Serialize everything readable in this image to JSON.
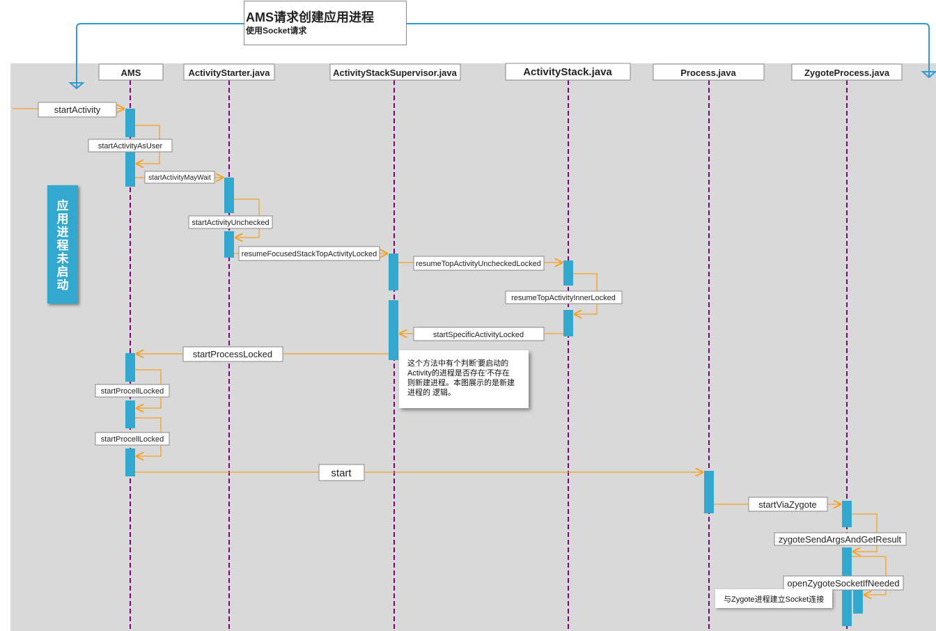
{
  "title": {
    "main": "AMS请求创建应用进程",
    "sub": "使用Socket请求"
  },
  "side_label": [
    "应",
    "用",
    "进",
    "程",
    "未",
    "启",
    "动"
  ],
  "participants": [
    "AMS",
    "ActivityStarter.java",
    "ActivityStackSupervisor.java",
    "ActivityStack.java",
    "Process.java",
    "ZygoteProcess.java"
  ],
  "messages": {
    "startActivity": "startActivity",
    "startActivityAsUser": "startActivityAsUser",
    "startActivityMayWait": "startActivityMayWait",
    "startActivityUnchecked": "startActivityUnchecked",
    "resumeFocusedStackTopActivityLocked": "resumeFocusedStackTopActivityLocked",
    "resumeTopActivityUncheckedLocked": "resumeTopActivityUncheckedLocked",
    "resumeTopActivityInnerLocked": "resumeTopActivityInnerLocked",
    "startSpecificActivityLocked": "startSpecificActivityLocked",
    "startProcessLocked": "startProcessLocked",
    "startProcellLocked_1": "startProcellLocked",
    "startProcellLocked_2": "startProcellLocked",
    "start": "start",
    "startViaZygote": "startViaZygote",
    "zygoteSendArgsAndGetResult": "zygoteSendArgsAndGetResult",
    "openZygoteSocketIfNeeded": "openZygoteSocketIfNeeded"
  },
  "notes": {
    "process_check": [
      "这个方法中有个判断'要启动的",
      "Activity的进程是否存在'不存在",
      "则新建进程。本图展示的是新建",
      "进程的 逻辑。"
    ],
    "socket": "与Zygote进程建立Socket连接"
  },
  "colors": {
    "canvas_bg": "#d9d9d9",
    "lifeline": "#800080",
    "activation": "#33a8cf",
    "arrow": "#f5a020",
    "frame_line": "#2b9ad6"
  }
}
